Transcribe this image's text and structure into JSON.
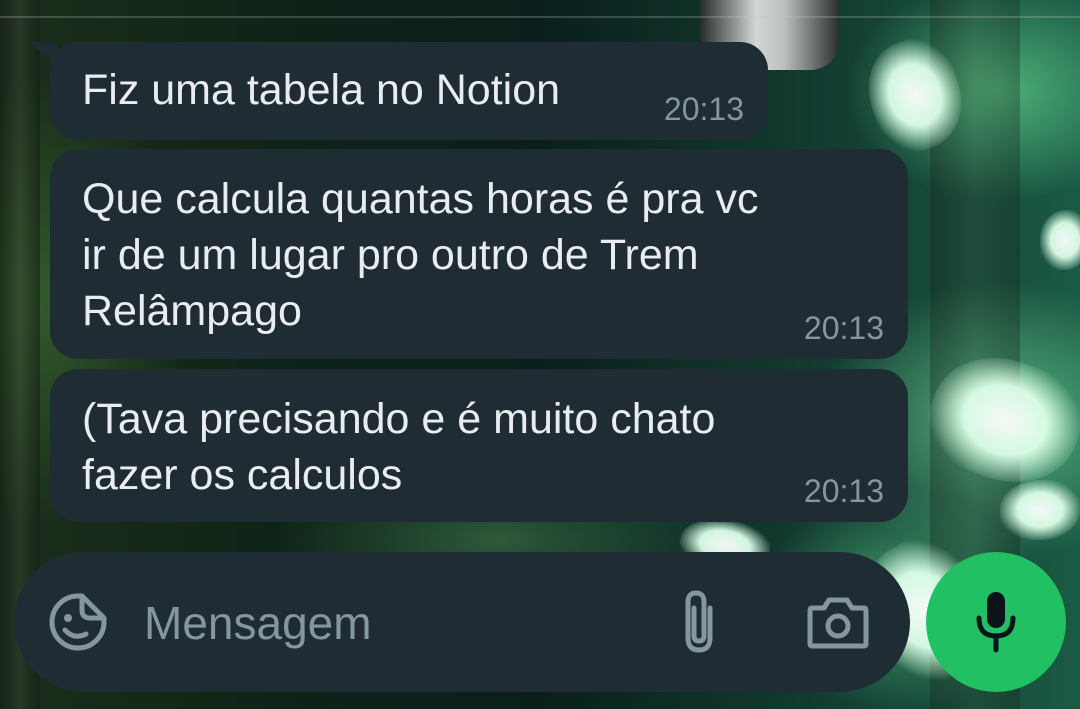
{
  "colors": {
    "bubble_bg": "#1f2c34",
    "text": "#e9edef",
    "meta_text": "#8696a0",
    "mic_button": "#21c063"
  },
  "messages": [
    {
      "text_lines": [
        "Fiz uma tabela no Notion"
      ],
      "time": "20:13"
    },
    {
      "text_lines": [
        "Que calcula quantas horas é pra vc",
        "ir de um lugar pro outro de Trem",
        "Relâmpago"
      ],
      "time": "20:13"
    },
    {
      "text_lines": [
        "(Tava precisando e é muito chato",
        "fazer os calculos"
      ],
      "time": "20:13"
    }
  ],
  "composer": {
    "placeholder": "Mensagem",
    "value": "",
    "icons": {
      "sticker": "sticker-emoji-icon",
      "attach": "paperclip-icon",
      "camera": "camera-icon",
      "mic": "microphone-icon"
    }
  }
}
